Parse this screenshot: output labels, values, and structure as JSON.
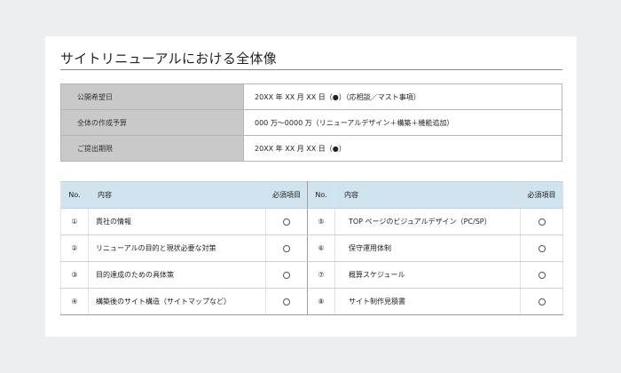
{
  "title": "サイトリニューアルにおける全体像",
  "info_rows": [
    {
      "label": "公開希望日",
      "value": "20XX 年 XX 月 XX 日（●）（応相談／マスト事項）"
    },
    {
      "label": "全体の作成予算",
      "value": "000 万〜0000 万（リニューアルデザイン＋構築＋機能追加）"
    },
    {
      "label": "ご提出期限",
      "value": "20XX 年 XX 月 XX 日（●）"
    }
  ],
  "items_header": {
    "no": "No.",
    "content": "内容",
    "required": "必須項目"
  },
  "items_left": [
    {
      "no": "①",
      "content": "貴社の情報",
      "required_icon": "empty-circle"
    },
    {
      "no": "②",
      "content": "リニューアルの目的と現状必要な対策",
      "required_icon": "empty-circle"
    },
    {
      "no": "③",
      "content": "目的達成のための具体策",
      "required_icon": "empty-circle"
    },
    {
      "no": "④",
      "content": "構築後のサイト構造（サイトマップなど）",
      "required_icon": "empty-circle"
    }
  ],
  "items_right": [
    {
      "no": "⑤",
      "content": "TOP ページのビジュアルデザイン（PC/SP）",
      "required_icon": "empty-circle"
    },
    {
      "no": "⑥",
      "content": "保守運用体制",
      "required_icon": "empty-circle"
    },
    {
      "no": "⑦",
      "content": "概算スケジュール",
      "required_icon": "empty-circle"
    },
    {
      "no": "⑧",
      "content": "サイト制作見積書",
      "required_icon": "empty-circle"
    }
  ],
  "colors": {
    "background": "#eceeef",
    "label_cell": "#c9c9c9",
    "header_cell": "#cfe4ee"
  }
}
